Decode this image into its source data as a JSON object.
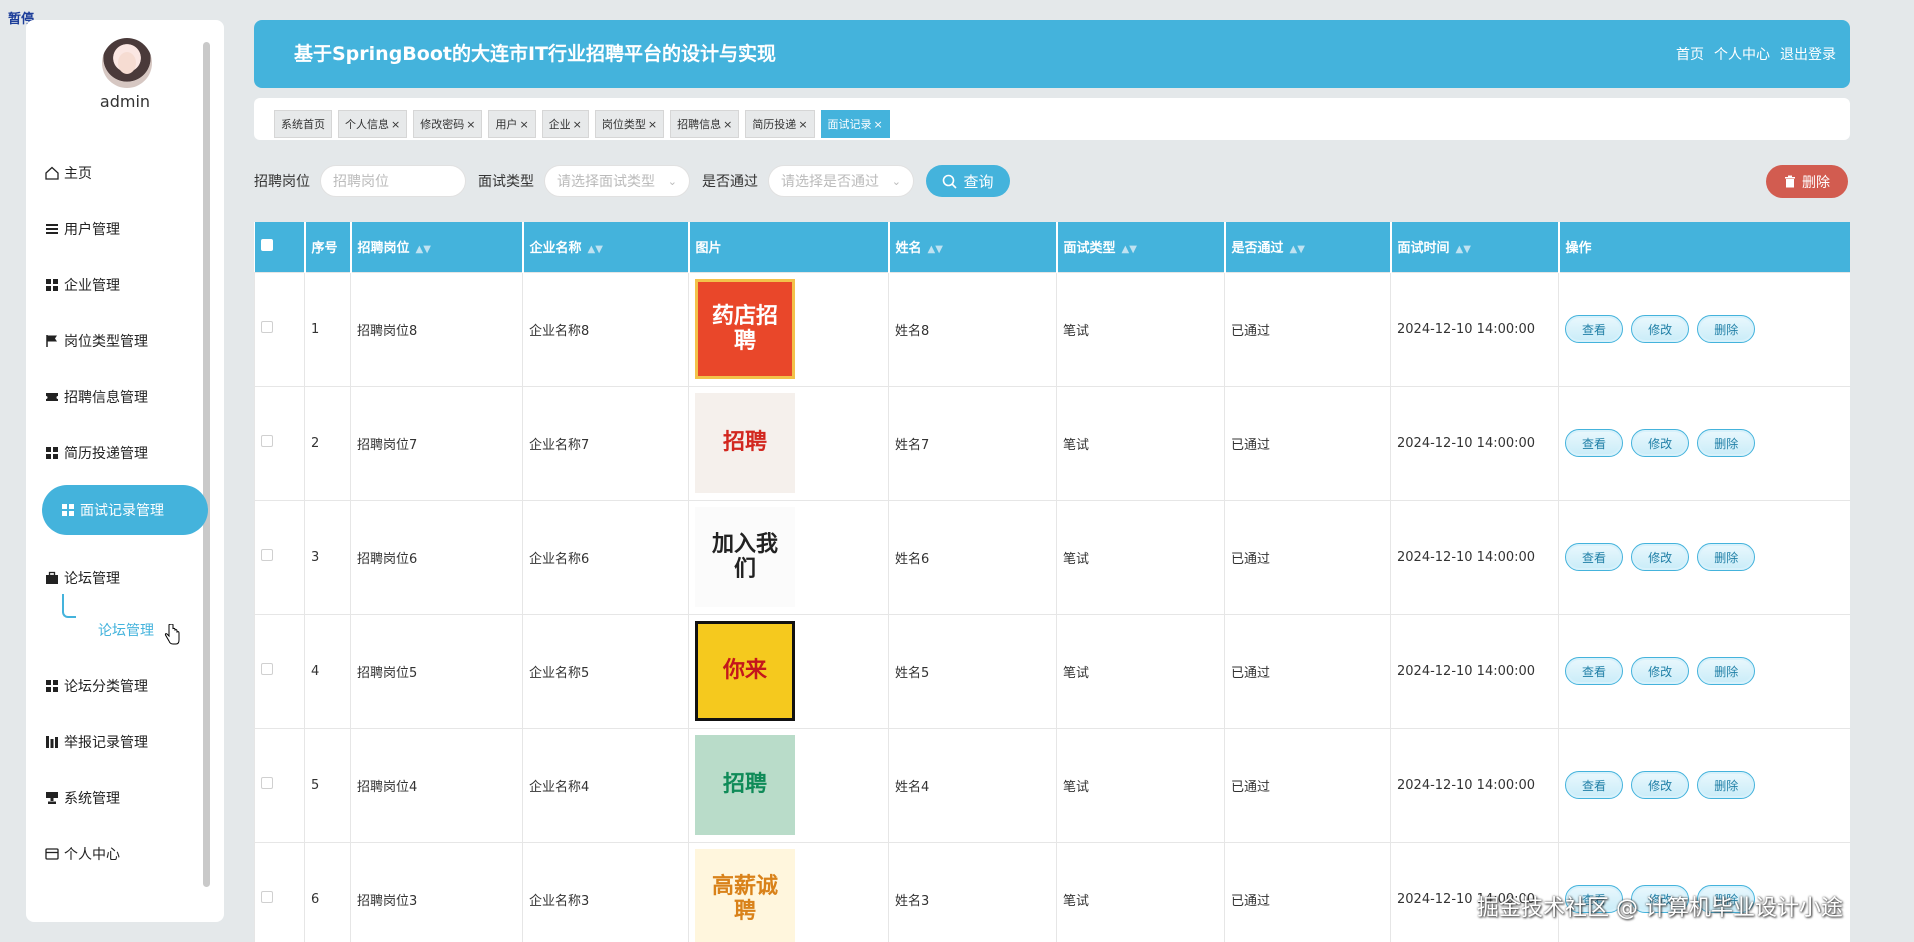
{
  "status": {
    "pause": "暂停"
  },
  "sidebar": {
    "username": "admin",
    "items": [
      {
        "label": "主页",
        "icon": "home-icon"
      },
      {
        "label": "用户管理",
        "icon": "list-icon"
      },
      {
        "label": "企业管理",
        "icon": "grid-icon"
      },
      {
        "label": "岗位类型管理",
        "icon": "flag-icon"
      },
      {
        "label": "招聘信息管理",
        "icon": "ticket-icon"
      },
      {
        "label": "简历投递管理",
        "icon": "grid-icon"
      },
      {
        "label": "面试记录管理",
        "icon": "grid-icon",
        "active": true
      },
      {
        "label": "论坛管理",
        "icon": "briefcase-icon"
      },
      {
        "label": "论坛分类管理",
        "icon": "grid-icon"
      },
      {
        "label": "举报记录管理",
        "icon": "chart-icon"
      },
      {
        "label": "系统管理",
        "icon": "cup-icon"
      },
      {
        "label": "个人中心",
        "icon": "card-icon"
      }
    ],
    "sub_item": "论坛管理"
  },
  "header": {
    "title": "基于SpringBoot的大连市IT行业招聘平台的设计与实现",
    "links": [
      "首页",
      "个人中心",
      "退出登录"
    ]
  },
  "tabs": [
    {
      "label": "系统首页",
      "close": ""
    },
    {
      "label": "个人信息",
      "close": "×"
    },
    {
      "label": "修改密码",
      "close": "×"
    },
    {
      "label": "用户",
      "close": "×"
    },
    {
      "label": "企业",
      "close": "×"
    },
    {
      "label": "岗位类型",
      "close": "×"
    },
    {
      "label": "招聘信息",
      "close": "×"
    },
    {
      "label": "简历投递",
      "close": "×"
    },
    {
      "label": "面试记录",
      "close": "×",
      "active": true
    }
  ],
  "filters": {
    "position_label": "招聘岗位",
    "position_placeholder": "招聘岗位",
    "type_label": "面试类型",
    "type_placeholder": "请选择面试类型",
    "pass_label": "是否通过",
    "pass_placeholder": "请选择是否通过",
    "search_button": "查询",
    "delete_button": "删除"
  },
  "table": {
    "headers": [
      "序号",
      "招聘岗位",
      "企业名称",
      "图片",
      "姓名",
      "面试类型",
      "是否通过",
      "面试时间",
      "操作"
    ],
    "actions": [
      "查看",
      "修改",
      "删除"
    ],
    "rows": [
      {
        "no": "1",
        "position": "招聘岗位8",
        "company": "企业名称8",
        "image_text": "药店招聘",
        "name": "姓名8",
        "type": "笔试",
        "passed": "已通过",
        "time": "2024-12-10 14:00:00"
      },
      {
        "no": "2",
        "position": "招聘岗位7",
        "company": "企业名称7",
        "image_text": "招聘",
        "name": "姓名7",
        "type": "笔试",
        "passed": "已通过",
        "time": "2024-12-10 14:00:00"
      },
      {
        "no": "3",
        "position": "招聘岗位6",
        "company": "企业名称6",
        "image_text": "加入我们",
        "name": "姓名6",
        "type": "笔试",
        "passed": "已通过",
        "time": "2024-12-10 14:00:00"
      },
      {
        "no": "4",
        "position": "招聘岗位5",
        "company": "企业名称5",
        "image_text": "你来",
        "name": "姓名5",
        "type": "笔试",
        "passed": "已通过",
        "time": "2024-12-10 14:00:00"
      },
      {
        "no": "5",
        "position": "招聘岗位4",
        "company": "企业名称4",
        "image_text": "招聘",
        "name": "姓名4",
        "type": "笔试",
        "passed": "已通过",
        "time": "2024-12-10 14:00:00"
      },
      {
        "no": "6",
        "position": "招聘岗位3",
        "company": "企业名称3",
        "image_text": "高薪诚聘",
        "name": "姓名3",
        "type": "笔试",
        "passed": "已通过",
        "time": "2024-12-10 14:00:00"
      }
    ]
  },
  "watermark": "掘金技术社区 @ 计算机毕业设计小途"
}
